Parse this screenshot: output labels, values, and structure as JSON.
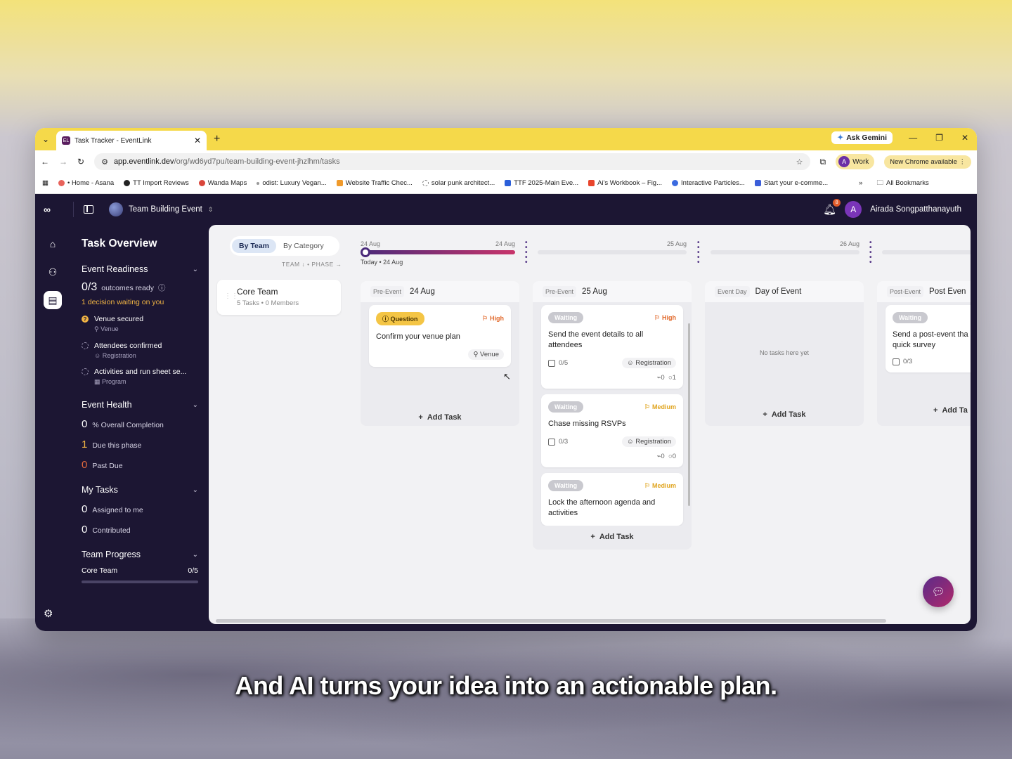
{
  "browser": {
    "tab_title": "Task Tracker - EventLink",
    "favicon": "EL",
    "ask_gemini": "Ask Gemini",
    "url_domain": "app.eventlink.dev",
    "url_path": "/org/wd6yd7pu/team-building-event-jhzlhm/tasks",
    "profile_letter": "A",
    "profile_label": "Work",
    "chrome_update": "New Chrome available",
    "bookmarks": [
      {
        "label": "• Home - Asana",
        "color": "#e8635b"
      },
      {
        "label": "TT Import Reviews",
        "color": "#222"
      },
      {
        "label": "Wanda Maps",
        "color": "#d9463b"
      },
      {
        "label": "odist: Luxury Vegan...",
        "color": "#999"
      },
      {
        "label": "Website Traffic Chec...",
        "color": "#f09a2b"
      },
      {
        "label": "solar punk architect...",
        "color": "#777"
      },
      {
        "label": "TTF 2025-Main Eve...",
        "color": "#2b5fd9"
      },
      {
        "label": "Ai's Workbook – Fig...",
        "color": "#e8452c"
      },
      {
        "label": "Interactive Particles...",
        "color": "#3b6be0"
      },
      {
        "label": "Start your e-comme...",
        "color": "#3b5ed9"
      }
    ],
    "all_bookmarks": "All Bookmarks"
  },
  "app": {
    "event_name": "Team Building Event",
    "notif_count": "8",
    "user_initial": "A",
    "user_name": "Airada Songpatthanayuth"
  },
  "sidebar": {
    "title": "Task Overview",
    "readiness": {
      "heading": "Event Readiness",
      "count": "0/3",
      "count_label": "outcomes ready",
      "warning": "1 decision waiting on you",
      "items": [
        {
          "label": "Venue secured",
          "sub": "Venue"
        },
        {
          "label": "Attendees confirmed",
          "sub": "Registration"
        },
        {
          "label": "Activities and run sheet se...",
          "sub": "Program"
        }
      ]
    },
    "health": {
      "heading": "Event Health",
      "completion": "0",
      "completion_label": "% Overall Completion",
      "due": "1",
      "due_label": "Due this phase",
      "past": "0",
      "past_label": "Past Due"
    },
    "my_tasks": {
      "heading": "My Tasks",
      "assigned": "0",
      "assigned_label": "Assigned to me",
      "contributed": "0",
      "contributed_label": "Contributed"
    },
    "team_progress": {
      "heading": "Team Progress",
      "team": "Core Team",
      "value": "0/5",
      "fraction": 0
    }
  },
  "board": {
    "toggle": [
      "By Team",
      "By Category"
    ],
    "team_phase": "TEAM ↓ • PHASE →",
    "team_card": {
      "name": "Core Team",
      "meta": "5 Tasks • 0 Members"
    },
    "timeline": {
      "seg1_start": "24 Aug",
      "seg1_end": "24 Aug",
      "today": "Today • 24 Aug",
      "seg2_end": "25 Aug",
      "seg3_end": "26 Aug"
    },
    "columns": [
      {
        "phase": "Pre-Event",
        "date": "24 Aug",
        "add_label": "Add Task",
        "cards": [
          {
            "status": "Question",
            "priority": "High",
            "title": "Confirm your venue plan",
            "tag": "Venue"
          }
        ]
      },
      {
        "phase": "Pre-Event",
        "date": "25 Aug",
        "add_label": "Add Task",
        "cards": [
          {
            "status": "Waiting",
            "priority": "High",
            "title": "Send the event details to all attendees",
            "check": "0/5",
            "tag": "Registration",
            "attach": "0",
            "comments": "1"
          },
          {
            "status": "Waiting",
            "priority": "Medium",
            "title": "Chase missing RSVPs",
            "check": "0/3",
            "tag": "Registration",
            "attach": "0",
            "comments": "0"
          },
          {
            "status": "Waiting",
            "priority": "Medium",
            "title": "Lock the afternoon agenda and activities"
          }
        ]
      },
      {
        "phase": "Event Day",
        "date": "Day of Event",
        "empty": "No tasks here yet",
        "add_label": "Add Task"
      },
      {
        "phase": "Post-Event",
        "date": "Post Even",
        "add_label": "Add Ta",
        "cards": [
          {
            "status": "Waiting",
            "title": "Send a post-event tha quick survey",
            "check": "0/3"
          }
        ]
      }
    ]
  },
  "caption": "And AI turns your idea into an actionable plan."
}
